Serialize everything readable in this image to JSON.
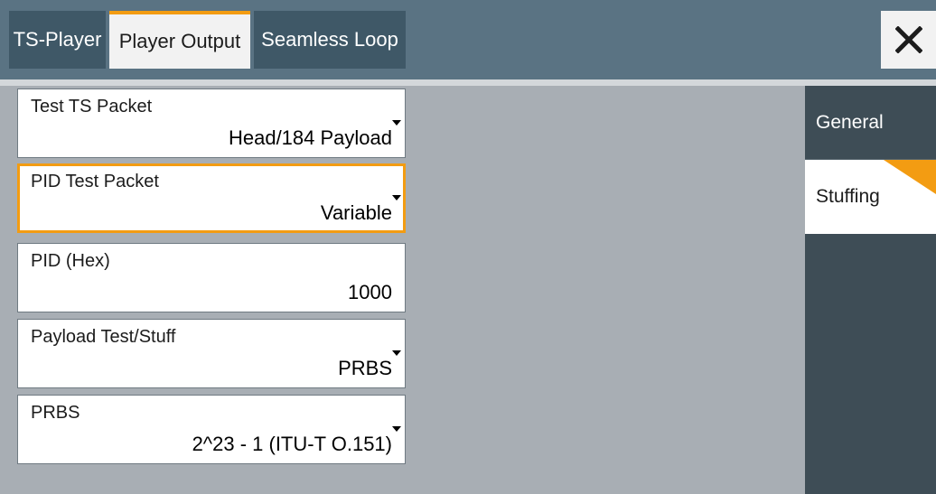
{
  "tabs": [
    {
      "label": "TS-Player",
      "active": false
    },
    {
      "label": "Player Output",
      "active": true
    },
    {
      "label": "Seamless Loop",
      "active": false
    }
  ],
  "close_icon": "close-x-icon",
  "fields": [
    {
      "label": "Test TS Packet",
      "value": "Head/184 Payload",
      "type": "dropdown",
      "focused": false
    },
    {
      "label": "PID Test Packet",
      "value": "Variable",
      "type": "dropdown",
      "focused": true
    },
    {
      "label": "PID (Hex)",
      "value": "1000",
      "type": "numeric",
      "focused": false
    },
    {
      "label": "Payload Test/Stuff",
      "value": "PRBS",
      "type": "dropdown",
      "focused": false
    },
    {
      "label": "PRBS",
      "value": "2^23 - 1 (ITU-T O.151)",
      "type": "dropdown",
      "focused": false
    }
  ],
  "side_nav": [
    {
      "label": "General",
      "active": false
    },
    {
      "label": "Stuffing",
      "active": true
    }
  ],
  "colors": {
    "accent": "#f39c12",
    "tabbar": "#5a7383",
    "tab_inactive": "#3f5867",
    "panel_bg": "#a8aeb4",
    "sidenav": "#3e4d56"
  }
}
